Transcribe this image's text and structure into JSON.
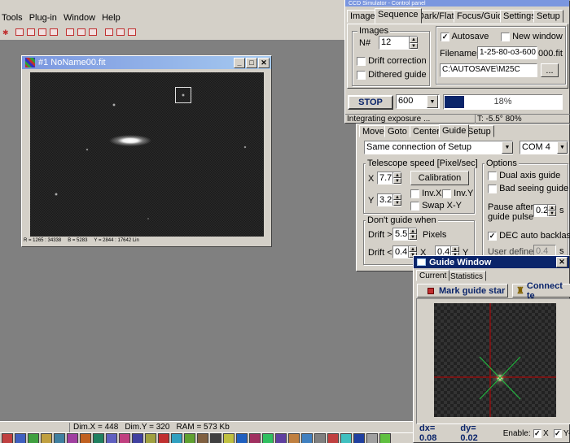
{
  "menu": {
    "items": [
      "Tools",
      "Plug-in",
      "Window",
      "Help"
    ]
  },
  "toolbar": {
    "icon_count": 10
  },
  "image_window": {
    "title": "#1 NoName00.fit",
    "status": {
      "r": "R = 1265 : 34338",
      "b": "B = 5283",
      "y": "Y = 2844 : 17642 Lin"
    }
  },
  "status_bar": {
    "dimx": "Dim.X = 448",
    "dimy": "Dim.Y = 320",
    "ram": "RAM = 573 Kb"
  },
  "ccd_panel": {
    "title": "CCD Simulator - Control panel",
    "tabs": [
      "Image",
      "Sequence",
      "Dark/Flat",
      "Focus/Guide",
      "Settings",
      "Setup"
    ],
    "images_group": "Images",
    "n_label": "N#",
    "n_value": "12",
    "autosave_label": "Autosave",
    "autosave_checked": true,
    "new_window_label": "New window",
    "new_window_checked": false,
    "drift_label": "Drift correction",
    "dithered_label": "Dithered guide",
    "filenames_label": "Filenames",
    "filenames_value": "1-25-80-o3-600",
    "filenames_suffix": "000.fit",
    "path_value": "C:\\AUTOSAVE\\M25C",
    "browse_label": "...",
    "stop_label": "STOP",
    "exposure_value": "600",
    "progress_label": "18%",
    "progress_value": 0.18,
    "status_text": "Integrating exposure ...",
    "temp_text": "T: -5.5°  80%"
  },
  "guide_panel": {
    "tabs": [
      "Move",
      "Goto",
      "Center",
      "Guide",
      "Setup"
    ],
    "connection_value": "Same connection of Setup",
    "port_value": "COM 4",
    "speed_group": "Telescope speed  [Pixel/sec]",
    "x_label": "X",
    "x_value": "7.7",
    "y_label": "Y",
    "y_value": "3.2",
    "calibration_label": "Calibration",
    "invx_label": "Inv.X",
    "invy_label": "Inv.Y",
    "swap_label": "Swap X-Y",
    "dont_guide_group": "Don't guide when",
    "drift_gt_label": "Drift >",
    "drift_gt_value": "5.5",
    "pixels_label": "Pixels",
    "drift_lt_label": "Drift <",
    "drift_lt_x": "0.4",
    "drift_lt_x_label": "X",
    "drift_lt_y": "0.4",
    "drift_lt_y_label": "Y",
    "options_group": "Options",
    "dual_axis_label": "Dual axis guide",
    "bad_seeing_label": "Bad seeing guide",
    "pause_label_1": "Pause after",
    "pause_label_2": "guide pulse",
    "pause_value": "0.2",
    "pause_unit": "s",
    "dec_backlash_label": "DEC auto backlash",
    "dec_backlash_checked": true,
    "user_defined_label": "User defined",
    "user_defined_value": "0.4",
    "user_defined_unit": "s"
  },
  "guide_window": {
    "title": "Guide Window",
    "tabs": [
      "Current",
      "Statistics"
    ],
    "mark_label": "Mark guide star",
    "connect_label": "Connect te",
    "dx_text": "dx= 0.08",
    "dy_text": "dy= 0.02",
    "enable_label": "Enable:",
    "x_label": "X",
    "y_label": "Y-"
  },
  "colors": {
    "title_active": "#0a246a",
    "title_inactive": "#7a96df",
    "progress": "#0a246a",
    "face": "#d4d0c8"
  }
}
